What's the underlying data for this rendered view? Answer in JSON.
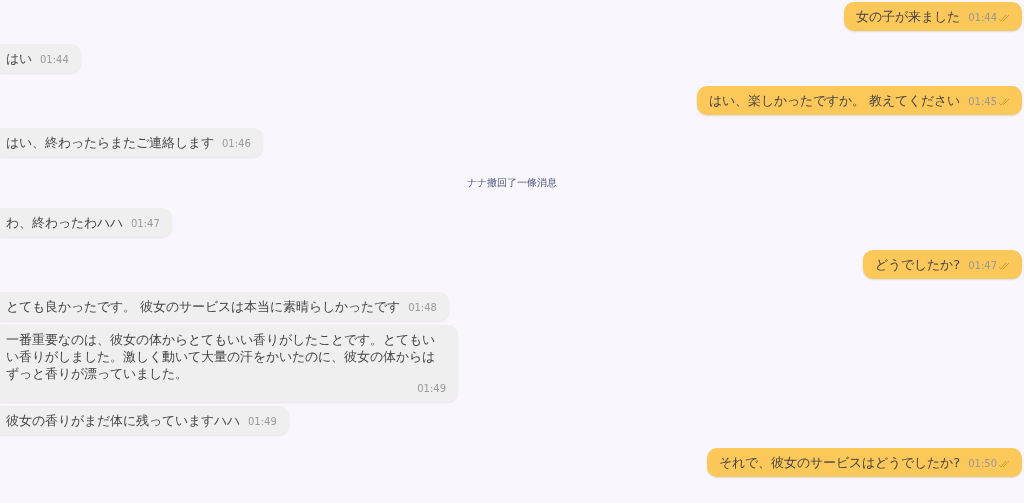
{
  "messages": [
    {
      "kind": "outgoing",
      "text": "女の子が来ました",
      "time": "01:44"
    },
    {
      "kind": "incoming",
      "text": "はい",
      "time": "01:44"
    },
    {
      "kind": "outgoing",
      "text": "はい、楽しかったですか。 教えてください",
      "time": "01:45"
    },
    {
      "kind": "incoming",
      "text": "はい、終わったらまたご連絡します",
      "time": "01:46"
    },
    {
      "kind": "system",
      "text": "ナナ撤回了一條消息"
    },
    {
      "kind": "incoming",
      "text": "わ、終わったわハハ",
      "time": "01:47"
    },
    {
      "kind": "outgoing",
      "text": "どうでしたか?",
      "time": "01:47"
    },
    {
      "kind": "incoming",
      "text": "とても良かったです。 彼女のサービスは本当に素晴らしかったです",
      "time": "01:48"
    },
    {
      "kind": "incoming",
      "text": "一番重要なのは、彼女の体からとてもいい香りがしたことです。とてもいい香りがしました。激しく動いて大量の汗をかいたのに、彼女の体からはずっと香りが漂っていました。",
      "time": "01:49"
    },
    {
      "kind": "incoming",
      "text": "彼女の香りがまだ体に残っていますハハ",
      "time": "01:49"
    },
    {
      "kind": "outgoing",
      "text": "それで、彼女のサービスはどうでしたか?",
      "time": "01:50"
    }
  ]
}
